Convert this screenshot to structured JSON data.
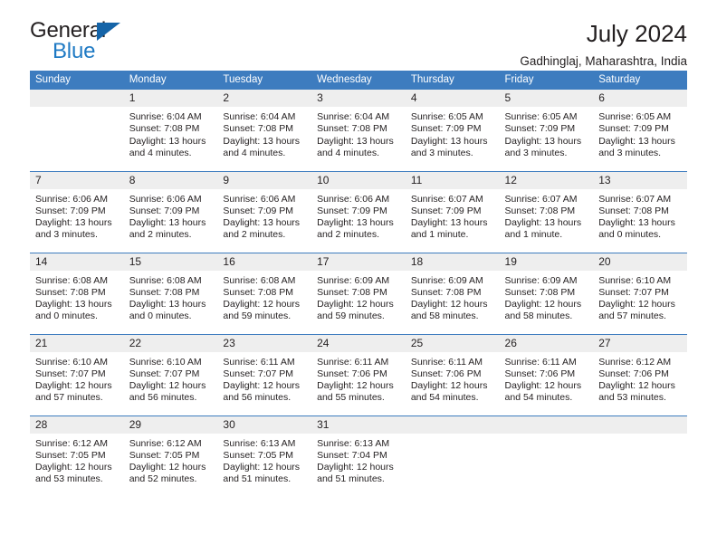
{
  "brand": {
    "name_top": "General",
    "name_bottom": "Blue",
    "triangle_color": "#1564a8",
    "blue_color": "#1f7ac4"
  },
  "header": {
    "title": "July 2024",
    "location": "Gadhinglaj, Maharashtra, India"
  },
  "theme": {
    "header_blue": "#3d7cbf",
    "daynum_gray": "#eeeeee",
    "text": "#231f20"
  },
  "weekdays": [
    "Sunday",
    "Monday",
    "Tuesday",
    "Wednesday",
    "Thursday",
    "Friday",
    "Saturday"
  ],
  "labels": {
    "sunrise_prefix": "Sunrise:",
    "sunset_prefix": "Sunset:",
    "daylight_prefix": "Daylight:"
  },
  "weeks": [
    [
      {
        "day": "",
        "blank": true
      },
      {
        "day": "1",
        "sunrise": "Sunrise: 6:04 AM",
        "sunset": "Sunset: 7:08 PM",
        "daylight": "Daylight: 13 hours and 4 minutes."
      },
      {
        "day": "2",
        "sunrise": "Sunrise: 6:04 AM",
        "sunset": "Sunset: 7:08 PM",
        "daylight": "Daylight: 13 hours and 4 minutes."
      },
      {
        "day": "3",
        "sunrise": "Sunrise: 6:04 AM",
        "sunset": "Sunset: 7:08 PM",
        "daylight": "Daylight: 13 hours and 4 minutes."
      },
      {
        "day": "4",
        "sunrise": "Sunrise: 6:05 AM",
        "sunset": "Sunset: 7:09 PM",
        "daylight": "Daylight: 13 hours and 3 minutes."
      },
      {
        "day": "5",
        "sunrise": "Sunrise: 6:05 AM",
        "sunset": "Sunset: 7:09 PM",
        "daylight": "Daylight: 13 hours and 3 minutes."
      },
      {
        "day": "6",
        "sunrise": "Sunrise: 6:05 AM",
        "sunset": "Sunset: 7:09 PM",
        "daylight": "Daylight: 13 hours and 3 minutes."
      }
    ],
    [
      {
        "day": "7",
        "sunrise": "Sunrise: 6:06 AM",
        "sunset": "Sunset: 7:09 PM",
        "daylight": "Daylight: 13 hours and 3 minutes."
      },
      {
        "day": "8",
        "sunrise": "Sunrise: 6:06 AM",
        "sunset": "Sunset: 7:09 PM",
        "daylight": "Daylight: 13 hours and 2 minutes."
      },
      {
        "day": "9",
        "sunrise": "Sunrise: 6:06 AM",
        "sunset": "Sunset: 7:09 PM",
        "daylight": "Daylight: 13 hours and 2 minutes."
      },
      {
        "day": "10",
        "sunrise": "Sunrise: 6:06 AM",
        "sunset": "Sunset: 7:09 PM",
        "daylight": "Daylight: 13 hours and 2 minutes."
      },
      {
        "day": "11",
        "sunrise": "Sunrise: 6:07 AM",
        "sunset": "Sunset: 7:09 PM",
        "daylight": "Daylight: 13 hours and 1 minute."
      },
      {
        "day": "12",
        "sunrise": "Sunrise: 6:07 AM",
        "sunset": "Sunset: 7:08 PM",
        "daylight": "Daylight: 13 hours and 1 minute."
      },
      {
        "day": "13",
        "sunrise": "Sunrise: 6:07 AM",
        "sunset": "Sunset: 7:08 PM",
        "daylight": "Daylight: 13 hours and 0 minutes."
      }
    ],
    [
      {
        "day": "14",
        "sunrise": "Sunrise: 6:08 AM",
        "sunset": "Sunset: 7:08 PM",
        "daylight": "Daylight: 13 hours and 0 minutes."
      },
      {
        "day": "15",
        "sunrise": "Sunrise: 6:08 AM",
        "sunset": "Sunset: 7:08 PM",
        "daylight": "Daylight: 13 hours and 0 minutes."
      },
      {
        "day": "16",
        "sunrise": "Sunrise: 6:08 AM",
        "sunset": "Sunset: 7:08 PM",
        "daylight": "Daylight: 12 hours and 59 minutes."
      },
      {
        "day": "17",
        "sunrise": "Sunrise: 6:09 AM",
        "sunset": "Sunset: 7:08 PM",
        "daylight": "Daylight: 12 hours and 59 minutes."
      },
      {
        "day": "18",
        "sunrise": "Sunrise: 6:09 AM",
        "sunset": "Sunset: 7:08 PM",
        "daylight": "Daylight: 12 hours and 58 minutes."
      },
      {
        "day": "19",
        "sunrise": "Sunrise: 6:09 AM",
        "sunset": "Sunset: 7:08 PM",
        "daylight": "Daylight: 12 hours and 58 minutes."
      },
      {
        "day": "20",
        "sunrise": "Sunrise: 6:10 AM",
        "sunset": "Sunset: 7:07 PM",
        "daylight": "Daylight: 12 hours and 57 minutes."
      }
    ],
    [
      {
        "day": "21",
        "sunrise": "Sunrise: 6:10 AM",
        "sunset": "Sunset: 7:07 PM",
        "daylight": "Daylight: 12 hours and 57 minutes."
      },
      {
        "day": "22",
        "sunrise": "Sunrise: 6:10 AM",
        "sunset": "Sunset: 7:07 PM",
        "daylight": "Daylight: 12 hours and 56 minutes."
      },
      {
        "day": "23",
        "sunrise": "Sunrise: 6:11 AM",
        "sunset": "Sunset: 7:07 PM",
        "daylight": "Daylight: 12 hours and 56 minutes."
      },
      {
        "day": "24",
        "sunrise": "Sunrise: 6:11 AM",
        "sunset": "Sunset: 7:06 PM",
        "daylight": "Daylight: 12 hours and 55 minutes."
      },
      {
        "day": "25",
        "sunrise": "Sunrise: 6:11 AM",
        "sunset": "Sunset: 7:06 PM",
        "daylight": "Daylight: 12 hours and 54 minutes."
      },
      {
        "day": "26",
        "sunrise": "Sunrise: 6:11 AM",
        "sunset": "Sunset: 7:06 PM",
        "daylight": "Daylight: 12 hours and 54 minutes."
      },
      {
        "day": "27",
        "sunrise": "Sunrise: 6:12 AM",
        "sunset": "Sunset: 7:06 PM",
        "daylight": "Daylight: 12 hours and 53 minutes."
      }
    ],
    [
      {
        "day": "28",
        "sunrise": "Sunrise: 6:12 AM",
        "sunset": "Sunset: 7:05 PM",
        "daylight": "Daylight: 12 hours and 53 minutes."
      },
      {
        "day": "29",
        "sunrise": "Sunrise: 6:12 AM",
        "sunset": "Sunset: 7:05 PM",
        "daylight": "Daylight: 12 hours and 52 minutes."
      },
      {
        "day": "30",
        "sunrise": "Sunrise: 6:13 AM",
        "sunset": "Sunset: 7:05 PM",
        "daylight": "Daylight: 12 hours and 51 minutes."
      },
      {
        "day": "31",
        "sunrise": "Sunrise: 6:13 AM",
        "sunset": "Sunset: 7:04 PM",
        "daylight": "Daylight: 12 hours and 51 minutes."
      },
      {
        "day": "",
        "blank": true
      },
      {
        "day": "",
        "blank": true
      },
      {
        "day": "",
        "blank": true
      }
    ]
  ]
}
